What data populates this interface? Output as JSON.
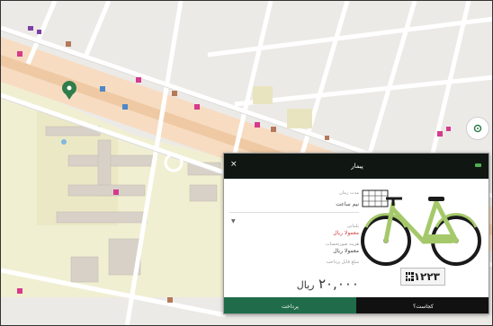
{
  "panel": {
    "title": "پیمار",
    "close_icon": "×",
    "duration_label": "مدت زمان",
    "duration_value": "نیم ساعت",
    "row1_label": "پلتبانی",
    "row1_value": "معمولا ریال",
    "row2_label": "هزینه صورتحساب",
    "row2_value": "معمولا ریال",
    "row3_label": "مبلغ قابل پرداخت",
    "price_value": "۲۰,۰۰۰",
    "price_unit": "ریال",
    "bike_id": "۱۲۲۳",
    "pay_button": "پرداخت",
    "where_button": "کجاست؟"
  },
  "colors": {
    "header": "#101713",
    "pay": "#1f6b4a",
    "accent_red": "#d23c3c",
    "bike_frame": "#a5c96a"
  },
  "icons": {
    "close": "close-icon",
    "battery": "battery-icon",
    "qr": "qr-code-icon",
    "location": "location-target-icon",
    "map_pin": "map-pin-icon",
    "dropdown": "chevron-down-icon"
  }
}
